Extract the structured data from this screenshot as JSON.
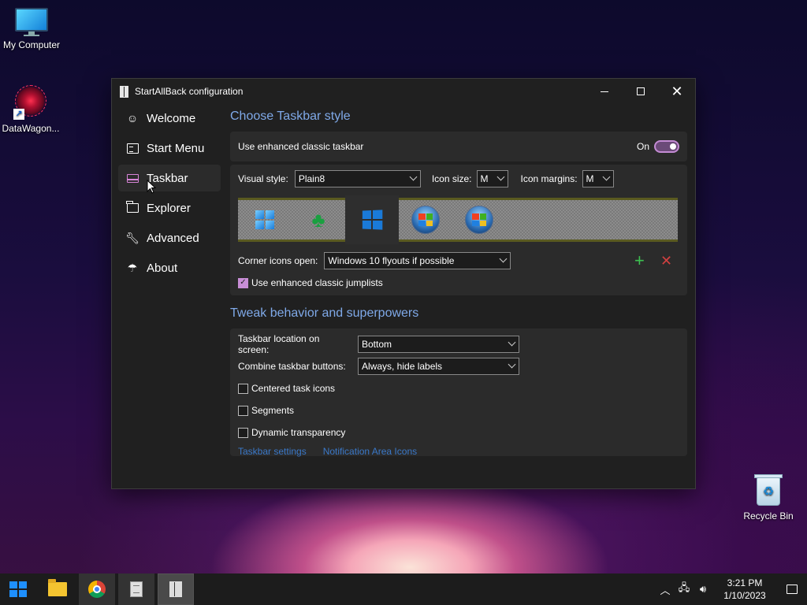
{
  "desktop": {
    "icons": [
      {
        "label": "My Computer"
      },
      {
        "label": "DataWagon..."
      },
      {
        "label": "Recycle Bin"
      }
    ]
  },
  "window": {
    "title": "StartAllBack configuration",
    "sidebar": {
      "items": [
        {
          "label": "Welcome",
          "icon": "smile-icon"
        },
        {
          "label": "Start Menu",
          "icon": "start-menu-icon"
        },
        {
          "label": "Taskbar",
          "icon": "taskbar-icon",
          "active": true
        },
        {
          "label": "Explorer",
          "icon": "folder-icon"
        },
        {
          "label": "Advanced",
          "icon": "wrench-icon"
        },
        {
          "label": "About",
          "icon": "umbrella-icon"
        }
      ]
    },
    "style_section": {
      "title": "Choose Taskbar style",
      "enhanced_label": "Use enhanced classic taskbar",
      "toggle_state_label": "On",
      "visual_style_label": "Visual style:",
      "visual_style_value": "Plain8",
      "icon_size_label": "Icon size:",
      "icon_size_value": "M",
      "icon_margins_label": "Icon margins:",
      "icon_margins_value": "M",
      "styles": [
        "windows-11-logo",
        "clover-logo",
        "windows-10-logo",
        "windows-7-orb",
        "windows-vista-orb"
      ],
      "selected_style_index": 2,
      "corner_icons_label": "Corner icons open:",
      "corner_icons_value": "Windows 10 flyouts if possible",
      "jumplists_label": "Use enhanced classic jumplists",
      "jumplists_checked": true
    },
    "behavior_section": {
      "title": "Tweak behavior and superpowers",
      "location_label": "Taskbar location on screen:",
      "location_value": "Bottom",
      "combine_label": "Combine taskbar buttons:",
      "combine_value": "Always, hide labels",
      "centered_label": "Centered task icons",
      "segments_label": "Segments",
      "dynamic_label": "Dynamic transparency",
      "link_taskbar_settings": "Taskbar settings",
      "link_notification_icons": "Notification Area Icons"
    }
  },
  "taskbar": {
    "clock_time": "3:21 PM",
    "clock_date": "1/10/2023"
  },
  "colors": {
    "accent": "#c88ed6",
    "section_title": "#7fa9e8",
    "link": "#3a78c8"
  }
}
